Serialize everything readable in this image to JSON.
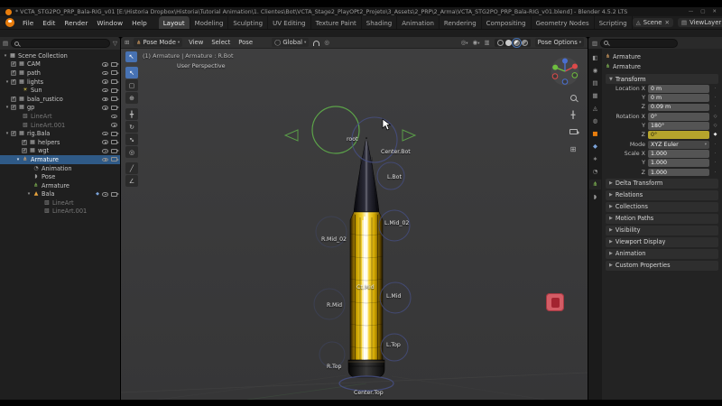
{
  "colors": {
    "accent": "#4772b3",
    "selection": "#2f5a87",
    "keyframe_yellow": "#b5a42c",
    "gold": "#f0c419",
    "orange": "#e87d0d",
    "control_green": "#5fae4a",
    "control_navy": "#464f82"
  },
  "window": {
    "title": "* VCTA_STG2PO_PRP_Bala-RIG_v01 [E:\\Historia Dropbox\\Historia\\Tutorial Animation\\1. Clientes\\Bot\\VCTA_Stage2_PlayOPt2_Projeto\\3_Assets\\2_PRP\\2_Arma\\VCTA_STG2PO_PRP_Bala-RIG_v01.blend] - Blender 4.5.2 LTS"
  },
  "menubar": {
    "menus": [
      "File",
      "Edit",
      "Render",
      "Window",
      "Help"
    ],
    "tabs": [
      "Layout",
      "Modeling",
      "Sculpting",
      "UV Editing",
      "Texture Paint",
      "Shading",
      "Animation",
      "Rendering",
      "Compositing",
      "Geometry Nodes",
      "Scripting"
    ],
    "scene": "Scene",
    "view_layer": "ViewLayer"
  },
  "outliner": {
    "rows": [
      {
        "label": "Scene Collection",
        "icon": "collection"
      },
      {
        "label": "CAM",
        "icon": "collection"
      },
      {
        "label": "path",
        "icon": "collection"
      },
      {
        "label": "lights",
        "icon": "collection"
      },
      {
        "label": "Sun",
        "icon": "light"
      },
      {
        "label": "bala_rustico",
        "icon": "collection"
      },
      {
        "label": "gp",
        "icon": "collection"
      },
      {
        "label": "LineArt",
        "icon": "lineart"
      },
      {
        "label": "LineArt.001",
        "icon": "lineart"
      },
      {
        "label": "rig.Bala",
        "icon": "collection"
      },
      {
        "label": "helpers",
        "icon": "collection"
      },
      {
        "label": "wgt",
        "icon": "collection"
      },
      {
        "label": "Armature",
        "icon": "armature-object"
      },
      {
        "label": "Animation",
        "icon": "animation"
      },
      {
        "label": "Pose",
        "icon": "pose"
      },
      {
        "label": "Armature",
        "icon": "armature-data"
      },
      {
        "label": "Bala",
        "icon": "mesh"
      },
      {
        "label": "LineArt",
        "icon": "modifier"
      },
      {
        "label": "LineArt.001",
        "icon": "modifier"
      }
    ]
  },
  "viewport": {
    "header": {
      "mode": "Pose Mode",
      "menus": [
        "View",
        "Select",
        "Pose"
      ],
      "orientation": "Global",
      "pose_options": "Pose Options"
    },
    "overlay": {
      "context_line": "(1) Armature | Armature : R.Bot",
      "view_label": "User Perspective"
    },
    "bone_labels": [
      "root",
      "Center.Bot",
      "L.Bot",
      "L.Mid_02",
      "R.Mid_02",
      "Ct.Mid",
      "L.Mid",
      "R.Mid",
      "L.Top",
      "R.Top",
      "Center.Top"
    ]
  },
  "properties": {
    "breadcrumb": "Armature",
    "name": "Armature",
    "transform_title": "Transform",
    "transform_rows": [
      {
        "label": "Location X",
        "value": "0 m"
      },
      {
        "label": "Y",
        "value": "0 m"
      },
      {
        "label": "Z",
        "value": "0.09 m"
      },
      {
        "label": "Rotation X",
        "value": "0°"
      },
      {
        "label": "Y",
        "value": "180°"
      },
      {
        "label": "Z",
        "value": "0°",
        "keyframed": true
      },
      {
        "label": "Mode",
        "value": "XYZ Euler"
      },
      {
        "label": "Scale X",
        "value": "1.000"
      },
      {
        "label": "Y",
        "value": "1.000"
      },
      {
        "label": "Z",
        "value": "1.000"
      }
    ],
    "sections": [
      "Delta Transform",
      "Relations",
      "Collections",
      "Motion Paths",
      "Visibility",
      "Viewport Display",
      "Animation",
      "Custom Properties"
    ]
  }
}
